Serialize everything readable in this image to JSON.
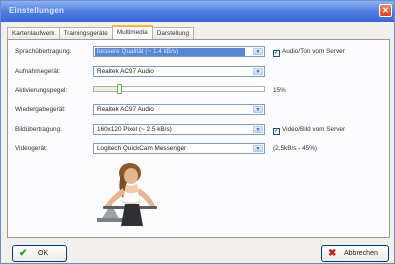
{
  "window": {
    "title": "Einstellungen",
    "close_glyph": "✕"
  },
  "tabs": [
    {
      "label": "Kartenlaufwerk",
      "active": false
    },
    {
      "label": "Trainingsgeräte",
      "active": false
    },
    {
      "label": "Multimedia",
      "active": true
    },
    {
      "label": "Darstellung",
      "active": false
    }
  ],
  "rows": {
    "sprach": {
      "label": "Sprachübertragung:",
      "value": "bessere Qualität (~ 1.4 kB/s)",
      "checkbox_label": "Audio/Ton vom Server",
      "checked": true
    },
    "aufnahme": {
      "label": "Aufnahmegerät:",
      "value": "Realtek AC97 Audio"
    },
    "pegel": {
      "label": "Aktivierungspegel:",
      "level_percent": 15,
      "level_text": "15%"
    },
    "wiedergabe": {
      "label": "Wiedergabegerät:",
      "value": "Realtek AC97 Audio"
    },
    "bild": {
      "label": "Bildübertragung:",
      "value": "160x120 Pixel (~ 2.5 kB/s)",
      "checkbox_label": "Video/Bild vom Server",
      "checked": true
    },
    "video": {
      "label": "Videogerät:",
      "value": "Logitech QuickCam Messenger",
      "note": "(2,5kB/s - 45%)"
    }
  },
  "buttons": {
    "ok": {
      "label": "OK",
      "icon": "checkmark-icon",
      "color": "#2e9a2e"
    },
    "cancel": {
      "label": "Abbrechen",
      "icon": "x-icon",
      "color": "#d02020"
    }
  },
  "colors": {
    "titlebar": "#3a67d4",
    "selection": "#316ac5",
    "active_tab_accent": "#f5b63d"
  }
}
